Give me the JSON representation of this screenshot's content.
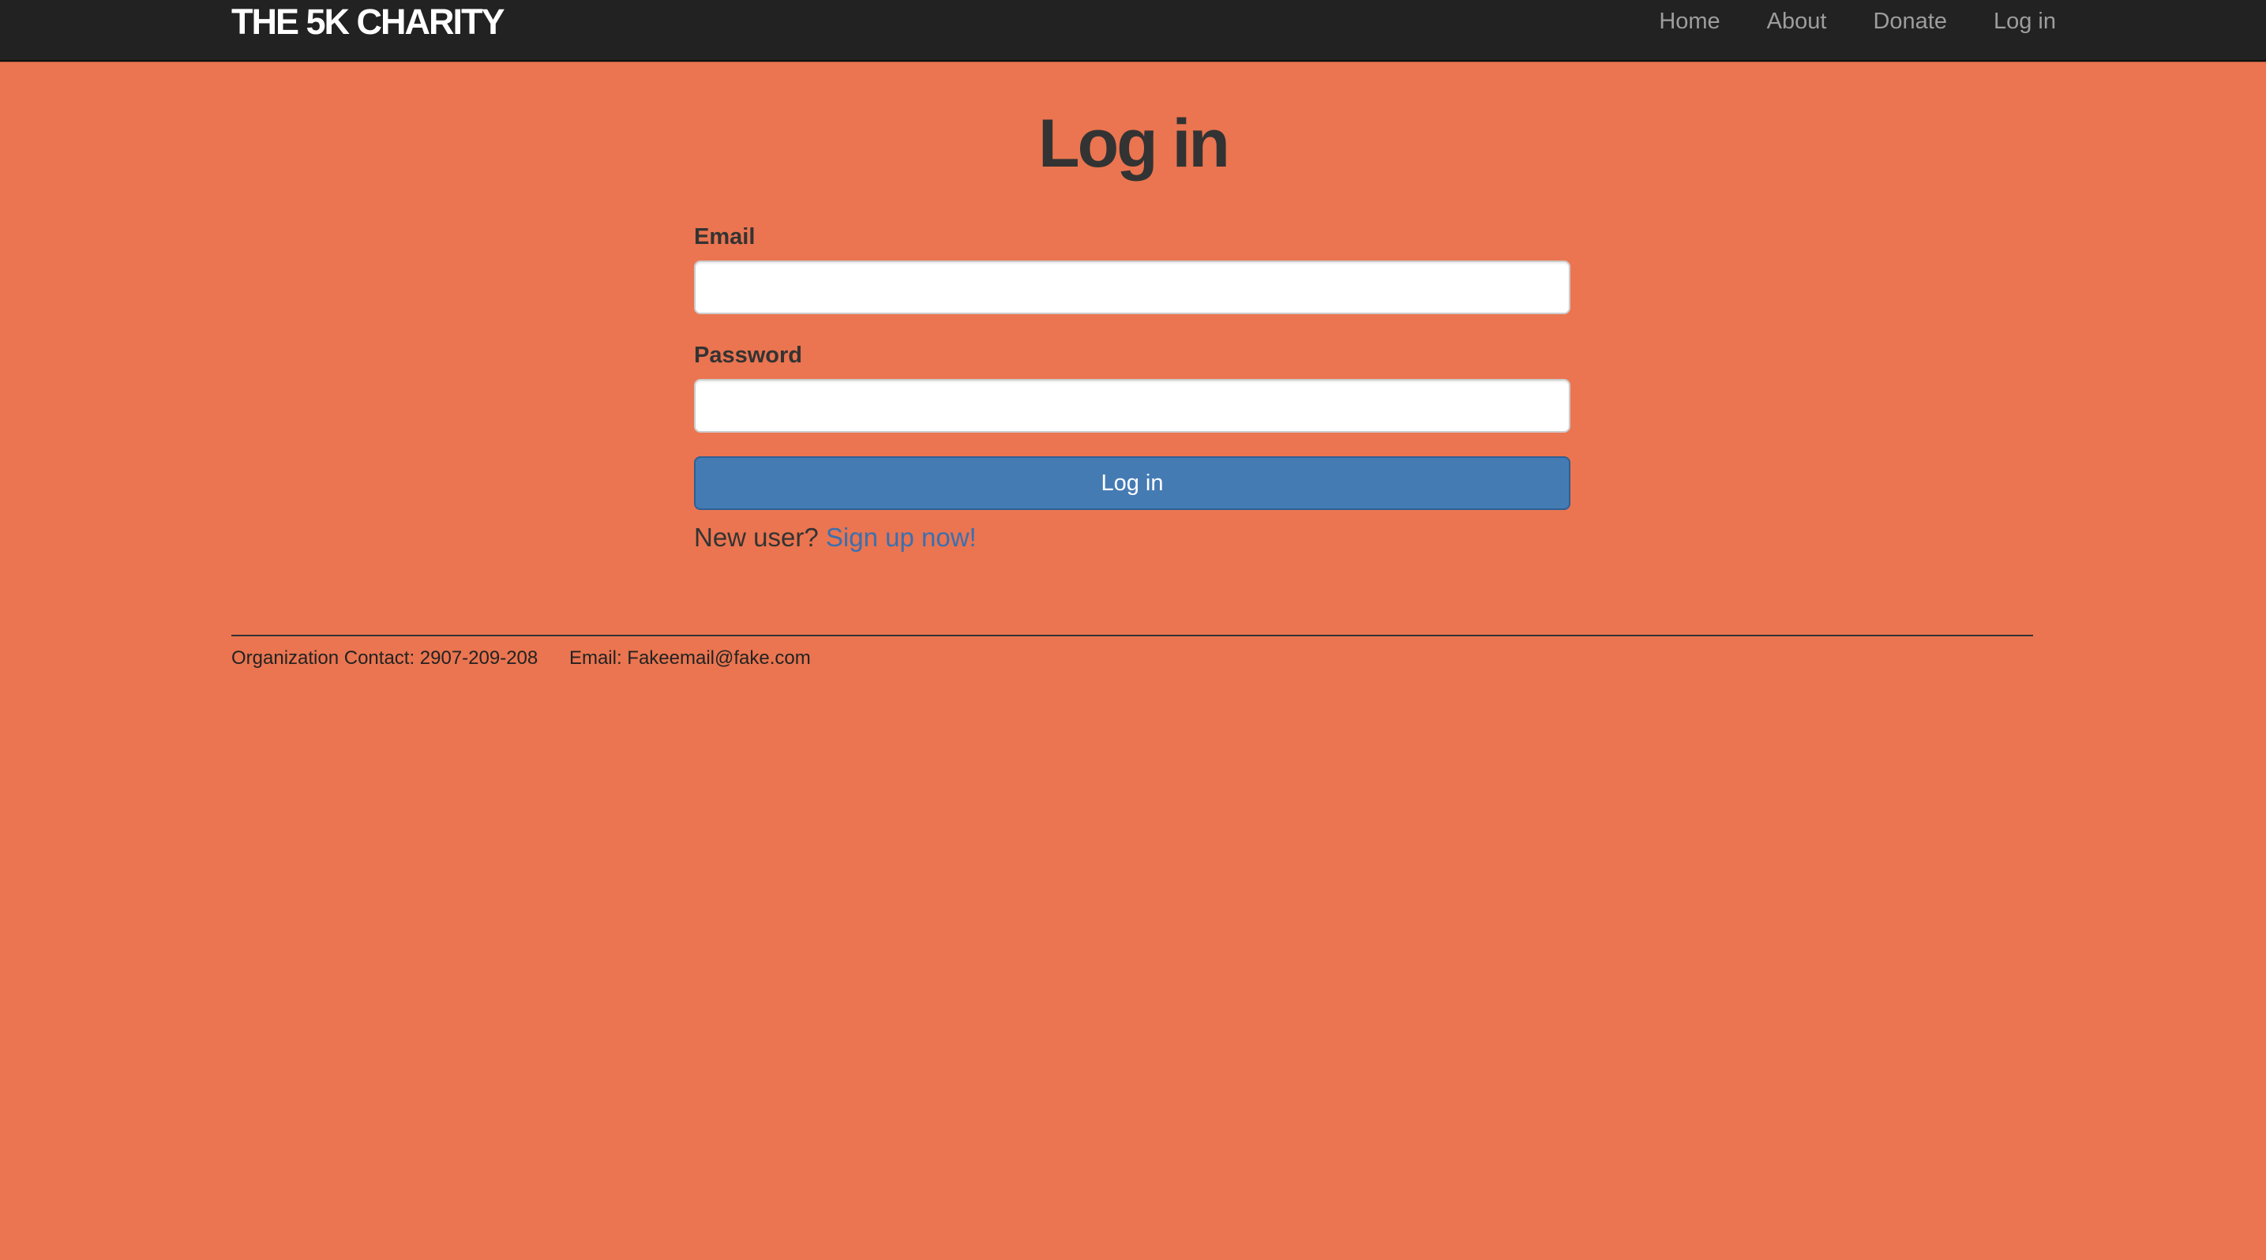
{
  "navbar": {
    "brand": "THE 5K CHARITY",
    "links": [
      {
        "label": "Home"
      },
      {
        "label": "About"
      },
      {
        "label": "Donate"
      },
      {
        "label": "Log in"
      }
    ]
  },
  "main": {
    "title": "Log in",
    "form": {
      "email_label": "Email",
      "email_value": "",
      "email_placeholder": "",
      "password_label": "Password",
      "password_value": "",
      "password_placeholder": "",
      "submit_label": "Log in",
      "signup_prompt": "New user?",
      "signup_link": "Sign up now!"
    }
  },
  "footer": {
    "contact": "Organization Contact: 2907-209-208",
    "email": "Email: Fakeemail@fake.com"
  },
  "colors": {
    "background": "#EA7550",
    "navbar": "#222222",
    "primary_button": "#457BB3",
    "link": "#3A6FB0"
  }
}
